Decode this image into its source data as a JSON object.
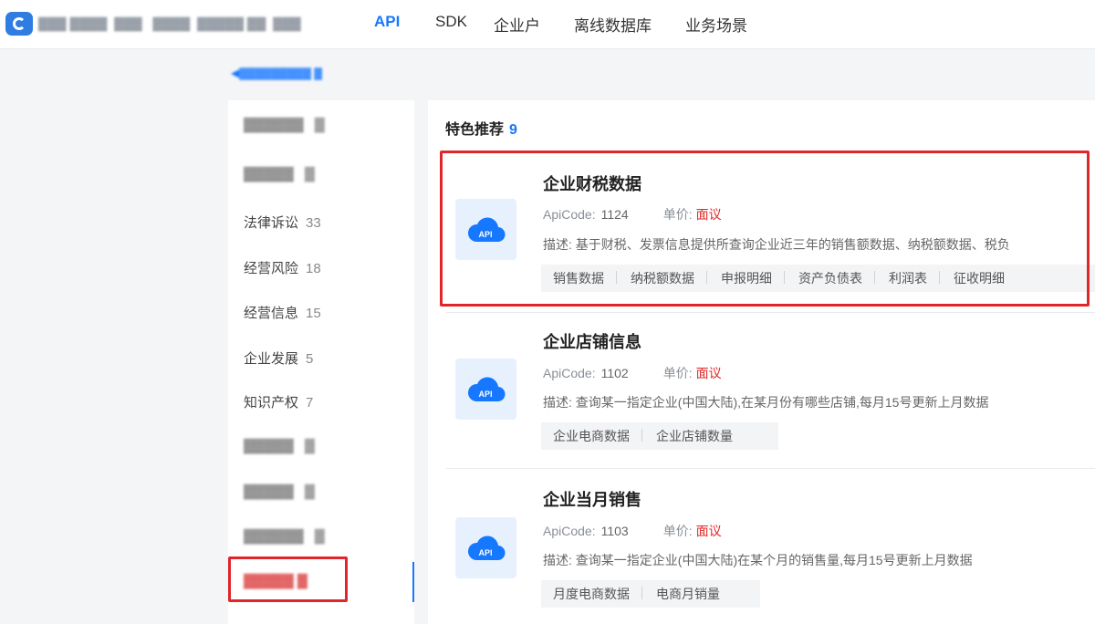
{
  "nav": {
    "items": [
      {
        "label": "API",
        "active": true
      },
      {
        "label": "SDK",
        "active": false
      },
      {
        "label": "企业户",
        "active": false
      },
      {
        "label": "离线数据库",
        "active": false
      },
      {
        "label": "业务场景",
        "active": false
      }
    ]
  },
  "sidebar": {
    "items": [
      {
        "label": "法律诉讼",
        "count": "33"
      },
      {
        "label": "经营风险",
        "count": "18"
      },
      {
        "label": "经营信息",
        "count": "15"
      },
      {
        "label": "企业发展",
        "count": "5"
      },
      {
        "label": "知识产权",
        "count": "7"
      }
    ]
  },
  "section": {
    "title": "特色推荐",
    "count": "9"
  },
  "cards": [
    {
      "title": "企业财税数据",
      "apicode_label": "ApiCode:",
      "apicode": "1124",
      "price_label": "单价:",
      "price": "面议",
      "desc_label": "描述:",
      "desc": "基于财税、发票信息提供所查询企业近三年的销售额数据、纳税额数据、税负",
      "tags": [
        "销售数据",
        "纳税额数据",
        "申报明细",
        "资产负债表",
        "利润表",
        "征收明细"
      ]
    },
    {
      "title": "企业店铺信息",
      "apicode_label": "ApiCode:",
      "apicode": "1102",
      "price_label": "单价:",
      "price": "面议",
      "desc_label": "描述:",
      "desc": "查询某一指定企业(中国大陆),在某月份有哪些店铺,每月15号更新上月数据",
      "tags": [
        "企业电商数据",
        "企业店铺数量"
      ]
    },
    {
      "title": "企业当月销售",
      "apicode_label": "ApiCode:",
      "apicode": "1103",
      "price_label": "单价:",
      "price": "面议",
      "desc_label": "描述:",
      "desc": "查询某一指定企业(中国大陆)在某个月的销售量,每月15号更新上月数据",
      "tags": [
        "月度电商数据",
        "电商月销量"
      ]
    }
  ],
  "icon_label": "API",
  "colors": {
    "accent": "#1677ff",
    "price": "#e02828",
    "highlight_box": "#e0262a",
    "icon_bg": "#e7f1fd"
  }
}
